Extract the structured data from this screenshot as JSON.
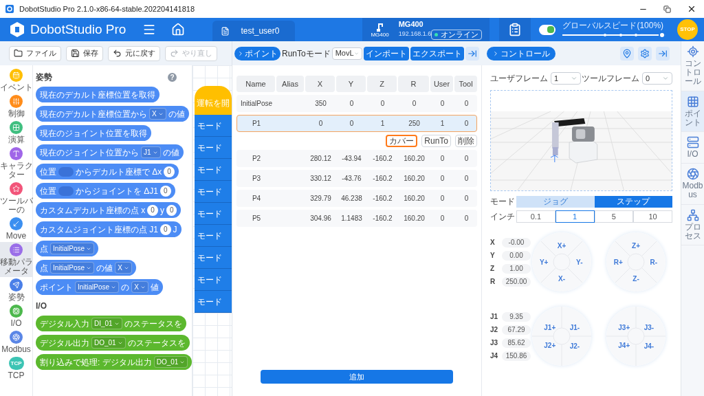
{
  "window": {
    "title": "DobotStudio Pro 2.1.0-x86-64-stable.202204141818"
  },
  "header": {
    "app_name": "DobotStudio Pro",
    "project_tab": "test_user0",
    "robot": {
      "icon_label": "MG400",
      "model": "MG400",
      "ip": "192.168.1.6",
      "status": "オンライン"
    },
    "switch": {
      "on": true
    },
    "speed": {
      "label": "グローバルスピード(100%)",
      "level": 1
    },
    "stop": "STOP"
  },
  "toolbar": [
    {
      "label": "ファイル",
      "disabled": false
    },
    {
      "label": "保存",
      "disabled": false
    },
    {
      "label": "元に戻す",
      "disabled": false
    },
    {
      "label": "やり直し",
      "disabled": true
    }
  ],
  "categories": [
    {
      "label": "イベント",
      "color": "#ffbf00",
      "selected": false
    },
    {
      "label": "制御",
      "color": "#ff8c1a",
      "selected": false
    },
    {
      "label": "演算",
      "color": "#40bf80",
      "selected": false
    },
    {
      "label": "キャラクター",
      "color": "#a066e8",
      "selected": false
    },
    {
      "label": "ツールバーの",
      "color": "#f2557a",
      "selected": false
    },
    {
      "label": "Move",
      "color": "#3b8ff0",
      "selected": false
    },
    {
      "label": "移動パラメータ",
      "color": "#9a6ee8",
      "selected": true
    },
    {
      "label": "姿勢",
      "color": "#4a7fe8",
      "selected": false
    },
    {
      "label": "I/O",
      "color": "#4cb84c",
      "selected": false
    },
    {
      "label": "Modbus",
      "color": "#5a86e6",
      "selected": false
    },
    {
      "label": "TCP",
      "color": "#3cc4b4",
      "selected": false,
      "badge": "TCP"
    }
  ],
  "palette": {
    "help": "?",
    "sections": [
      {
        "title": "姿勢",
        "color": "#4c8cf5",
        "blocks": [
          [
            {
              "kind": "text",
              "text": "現在のデカルト座標位置を取得"
            }
          ],
          [
            {
              "kind": "text",
              "text": "現在のデカルト座標位置から"
            },
            {
              "kind": "dropdown",
              "text": "X"
            },
            {
              "kind": "text",
              "text": "の値"
            }
          ],
          [
            {
              "kind": "text",
              "text": "現在のジョイント位置を取得"
            }
          ],
          [
            {
              "kind": "text",
              "text": "現在のジョイント位置から"
            },
            {
              "kind": "dropdown",
              "text": "J1"
            },
            {
              "kind": "text",
              "text": "の値"
            }
          ],
          [
            {
              "kind": "text",
              "text": "位置"
            },
            {
              "kind": "slot"
            },
            {
              "kind": "text",
              "text": "からデカルト座標で Δx"
            },
            {
              "kind": "number",
              "text": "0"
            }
          ],
          [
            {
              "kind": "text",
              "text": "位置"
            },
            {
              "kind": "slot"
            },
            {
              "kind": "text",
              "text": "からジョイントを ΔJ1"
            },
            {
              "kind": "number",
              "text": "0"
            }
          ],
          [
            {
              "kind": "text",
              "text": "カスタムデカルト座標の点 x"
            },
            {
              "kind": "number",
              "text": "0"
            },
            {
              "kind": "text",
              "text": "y"
            },
            {
              "kind": "number",
              "text": "0"
            }
          ],
          [
            {
              "kind": "text",
              "text": "カスタムジョイント座標の点 J1"
            },
            {
              "kind": "number",
              "text": "0"
            },
            {
              "kind": "text",
              "text": "J"
            }
          ],
          [
            {
              "kind": "text",
              "text": "点"
            },
            {
              "kind": "dropdown",
              "text": "InitialPose"
            }
          ],
          [
            {
              "kind": "text",
              "text": "点"
            },
            {
              "kind": "dropdown",
              "text": "InitialPose"
            },
            {
              "kind": "text",
              "text": "の値"
            },
            {
              "kind": "dropdown",
              "text": "X"
            }
          ],
          [
            {
              "kind": "text",
              "text": "ポイント"
            },
            {
              "kind": "dropdown",
              "text": "InitialPose"
            },
            {
              "kind": "text",
              "text": "の"
            },
            {
              "kind": "dropdown",
              "text": "X"
            },
            {
              "kind": "text",
              "text": "値"
            }
          ]
        ]
      },
      {
        "title": "I/O",
        "color": "#5cb82e",
        "blocks": [
          [
            {
              "kind": "text",
              "text": "デジタル入力"
            },
            {
              "kind": "dropdown",
              "text": "DI_01"
            },
            {
              "kind": "text",
              "text": "のステータスを"
            }
          ],
          [
            {
              "kind": "text",
              "text": "デジタル出力"
            },
            {
              "kind": "dropdown",
              "text": "DO_01"
            },
            {
              "kind": "text",
              "text": "のステータスを"
            }
          ],
          [
            {
              "kind": "text",
              "text": "割り込みで処理: デジタル出力"
            },
            {
              "kind": "dropdown",
              "text": "DO_01"
            }
          ]
        ]
      }
    ]
  },
  "canvas": {
    "hat": "運転を開",
    "blocks": [
      "モード",
      "モード",
      "モード",
      "モード",
      "モード",
      "モード",
      "モード",
      "モード",
      "モード"
    ]
  },
  "points_panel": {
    "title": "ポイント",
    "runto_label": "RunToモード",
    "runto_value": "MovL",
    "buttons": [
      "インポート",
      "エクスポート"
    ],
    "table": {
      "columns": [
        "Name",
        "Alias",
        "X",
        "Y",
        "Z",
        "R",
        "User",
        "Tool"
      ],
      "rows": [
        {
          "name": "InitialPose",
          "values": [
            "350",
            "0",
            "0",
            "0",
            "0",
            "0"
          ],
          "selected": false
        },
        {
          "name": "P1",
          "values": [
            "0",
            "0",
            "1",
            "250",
            "1",
            "0"
          ],
          "selected": true,
          "actions": [
            {
              "label": "カバー",
              "highlighted": true
            },
            {
              "label": "RunTo",
              "highlighted": false
            },
            {
              "label": "削除",
              "highlighted": false
            }
          ]
        },
        {
          "name": "P2",
          "values": [
            "280.12",
            "-43.94",
            "-160.2",
            "160.20",
            "0",
            "0"
          ],
          "selected": false
        },
        {
          "name": "P3",
          "values": [
            "330.12",
            "-43.76",
            "-160.2",
            "160.20",
            "0",
            "0"
          ],
          "selected": false
        },
        {
          "name": "P4",
          "values": [
            "329.79",
            "46.238",
            "-160.2",
            "160.20",
            "0",
            "0"
          ],
          "selected": false
        },
        {
          "name": "P5",
          "values": [
            "304.96",
            "1.1483",
            "-160.2",
            "160.20",
            "0",
            "0"
          ],
          "selected": false
        }
      ]
    },
    "add_button": "追加"
  },
  "control_panel": {
    "title": "コントロール",
    "user_frame": {
      "label": "ユーザフレーム",
      "value": "1"
    },
    "tool_frame": {
      "label": "ツールフレーム",
      "value": "0"
    },
    "mode": {
      "label": "モード",
      "options": [
        {
          "label": "ジョグ",
          "selected": false
        },
        {
          "label": "ステップ",
          "selected": true
        }
      ]
    },
    "inch": {
      "label": "インチ",
      "options": [
        {
          "label": "0.1",
          "selected": false
        },
        {
          "label": "1",
          "selected": true
        },
        {
          "label": "5",
          "selected": false
        },
        {
          "label": "10",
          "selected": false
        }
      ]
    },
    "groups": [
      {
        "values": [
          {
            "axis": "X",
            "value": "-0.00"
          },
          {
            "axis": "Y",
            "value": "0.00"
          },
          {
            "axis": "Z",
            "value": "1.00"
          },
          {
            "axis": "R",
            "value": "250.00"
          }
        ],
        "pads": [
          {
            "kind": "cross",
            "labels": [
              "X+",
              "Y+",
              "Y-",
              "X-"
            ]
          },
          {
            "kind": "cross",
            "labels": [
              "Z+",
              "R+",
              "R-",
              "Z-"
            ]
          }
        ]
      },
      {
        "values": [
          {
            "axis": "J1",
            "value": "9.35"
          },
          {
            "axis": "J2",
            "value": "67.29"
          },
          {
            "axis": "J3",
            "value": "85.62"
          },
          {
            "axis": "J4",
            "value": "150.86"
          }
        ],
        "pads": [
          {
            "kind": "quad",
            "labels": [
              "J1+",
              "J1-",
              "J2+",
              "J2-"
            ]
          },
          {
            "kind": "quad",
            "labels": [
              "J3+",
              "J3-",
              "J4+",
              "J4-"
            ]
          }
        ]
      }
    ]
  },
  "right_sidebar": [
    {
      "label": "コントロール",
      "selected": false
    },
    {
      "label": "ポイント",
      "selected": true
    },
    {
      "label": "I/O",
      "selected": false
    },
    {
      "label": "Modbus",
      "selected": false
    },
    {
      "label": "プロセス",
      "selected": false
    }
  ]
}
